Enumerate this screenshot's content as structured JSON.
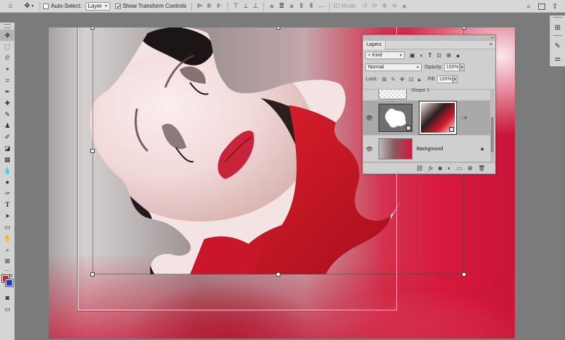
{
  "options_bar": {
    "home_icon": "home-icon",
    "move_icon": "move-tool-icon",
    "auto_select_label": "Auto-Select:",
    "auto_select_checked": false,
    "auto_select_target": "Layer",
    "show_transform_label": "Show Transform Controls",
    "show_transform_checked": true,
    "mode_3d_label": "3D Mode:"
  },
  "toolbar": {
    "tools": [
      "move",
      "marquee",
      "lasso",
      "quick-select",
      "crop",
      "eyedropper",
      "healing",
      "brush",
      "clone-stamp",
      "history-brush",
      "eraser",
      "gradient",
      "blur",
      "dodge",
      "pen",
      "type",
      "path-select",
      "rectangle",
      "hand",
      "zoom",
      "frame"
    ],
    "active_tool": "move",
    "foreground_color": "#e11c1c",
    "background_color": "#1f36d6"
  },
  "layers_panel": {
    "title": "Layers",
    "filter_kind": "Kind",
    "blend_mode": "Normal",
    "opacity_label": "Opacity:",
    "opacity_value": "100%",
    "lock_label": "Lock:",
    "fill_label": "Fill:",
    "fill_value": "100%",
    "layers": [
      {
        "name": "Shape 1",
        "visible": false,
        "type": "shape"
      },
      {
        "name": "",
        "visible": true,
        "type": "smart-object-masked",
        "selected": true
      },
      {
        "name": "Background",
        "visible": true,
        "type": "background",
        "locked": true
      }
    ]
  }
}
